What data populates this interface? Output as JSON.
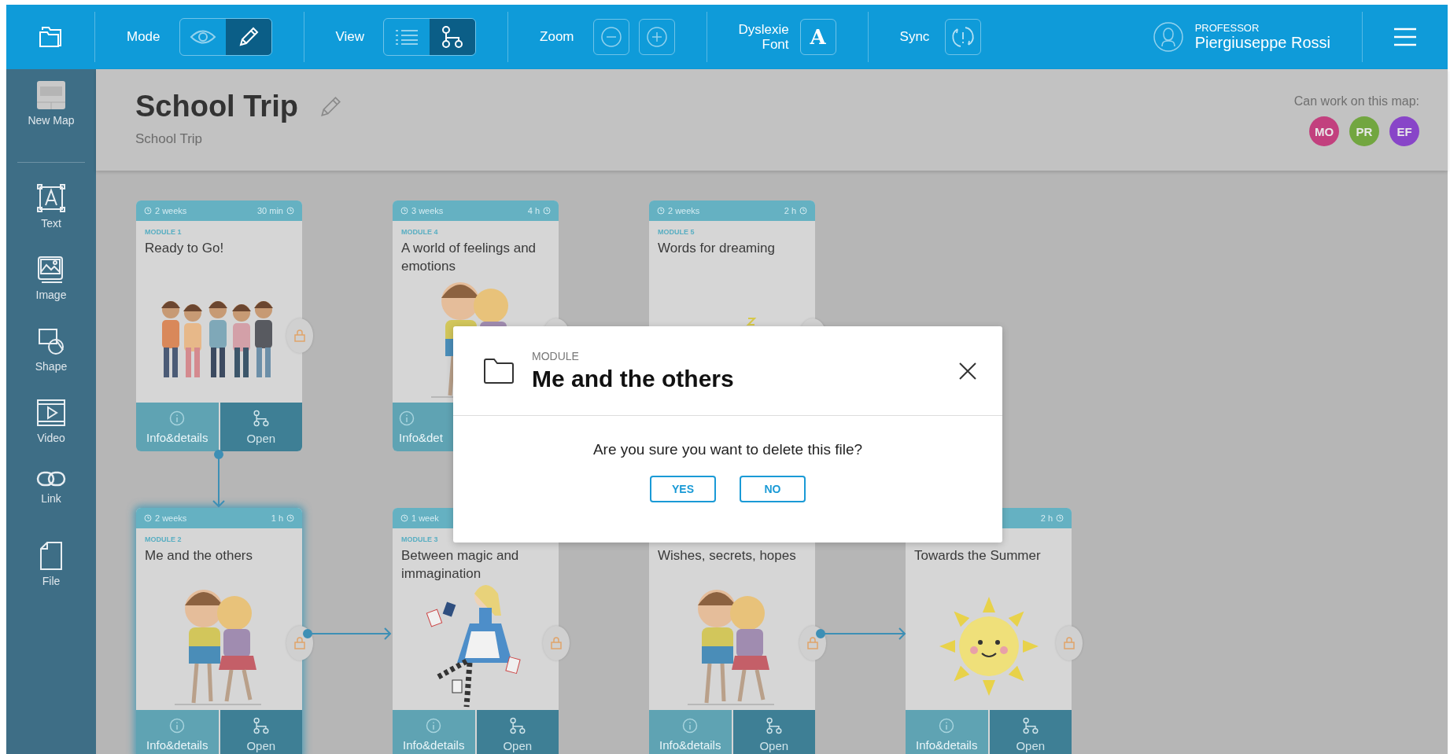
{
  "topbar": {
    "mode_label": "Mode",
    "mode_options": [
      {
        "kind": "eye",
        "selected": false
      },
      {
        "kind": "pencil",
        "selected": true
      }
    ],
    "view_label": "View",
    "view_options": [
      {
        "kind": "list",
        "selected": false
      },
      {
        "kind": "map",
        "selected": true
      }
    ],
    "zoom_label": "Zoom",
    "dyslexia_label": "Dyslexie Font",
    "font_button": "A",
    "sync_label": "Sync",
    "user_role": "PROFESSOR",
    "user_name": "Piergiuseppe Rossi"
  },
  "sidebar": {
    "items": [
      {
        "kind": "new-map",
        "label": "New Map"
      },
      {
        "kind": "text",
        "label": "Text"
      },
      {
        "kind": "image",
        "label": "Image"
      },
      {
        "kind": "shape",
        "label": "Shape"
      },
      {
        "kind": "video",
        "label": "Video"
      },
      {
        "kind": "link",
        "label": "Link"
      },
      {
        "kind": "file",
        "label": "File"
      }
    ]
  },
  "map": {
    "title": "School Trip",
    "subtitle": "School Trip",
    "collaborators_label": "Can work on this map:",
    "collaborators": [
      {
        "initials": "MO",
        "color": "#c2407e"
      },
      {
        "initials": "PR",
        "color": "#72a640"
      },
      {
        "initials": "EF",
        "color": "#8845c8"
      }
    ]
  },
  "rows": [
    [
      {
        "kind": "group",
        "duration": "2 weeks",
        "time": "30 min",
        "module": "MODULE 1",
        "title": "Ready to Go!",
        "info": "Info&details",
        "open": "Open",
        "selected": false
      },
      {
        "kind": "hug",
        "duration": "3 weeks",
        "time": "4 h",
        "module": "MODULE 4",
        "title": "A world of feelings and emotions",
        "info": "Info&det",
        "selected": false
      },
      {
        "kind": "sleep",
        "duration": "2 weeks",
        "time": "2 h",
        "module": "MODULE 5",
        "title": "Words for dreaming",
        "selected": false
      }
    ],
    [
      {
        "kind": "hug",
        "duration": "2 weeks",
        "time": "1 h",
        "module": "MODULE 2",
        "title": "Me and the others",
        "info": "Info&details",
        "open": "Open",
        "selected": true
      },
      {
        "kind": "magic",
        "duration": "1 week",
        "module": "MODULE 3",
        "title": "Between magic and immagination",
        "info": "Info&details",
        "open": "Open",
        "selected": false
      },
      {
        "kind": "hug",
        "title": "Wishes, secrets, hopes",
        "info": "Info&details",
        "open": "Open",
        "selected": false
      },
      {
        "kind": "sun",
        "time": "2 h",
        "title": "Towards the Summer",
        "info": "Info&details",
        "open": "Open",
        "selected": false
      }
    ]
  ],
  "dialog": {
    "label": "MODULE",
    "title": "Me and the others",
    "message": "Are you sure you want to delete this file?",
    "buttons": [
      "YES",
      "NO"
    ]
  }
}
